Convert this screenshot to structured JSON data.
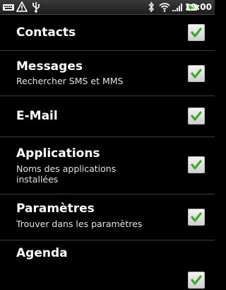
{
  "status_bar": {
    "time": "19:00",
    "left_icons": [
      "keyboard-icon",
      "warning-icon",
      "usb-debug-icon"
    ],
    "right_icons": [
      "bluetooth-icon",
      "wifi-icon",
      "signal-icon",
      "battery-icon"
    ]
  },
  "items": [
    {
      "title": "Contacts",
      "subtitle": "",
      "checked": true
    },
    {
      "title": "Messages",
      "subtitle": "Rechercher SMS et MMS",
      "checked": true
    },
    {
      "title": "E-Mail",
      "subtitle": "",
      "checked": true
    },
    {
      "title": "Applications",
      "subtitle_line1": "Noms des applications",
      "subtitle_line2": "installées",
      "checked": true
    },
    {
      "title": "Paramètres",
      "subtitle": "Trouver dans les paramètres",
      "checked": true
    },
    {
      "title": "Agenda",
      "subtitle": "",
      "checked": true
    }
  ],
  "colors": {
    "check_green": "#3dab24",
    "background": "#000000",
    "divider": "#3c3c3c"
  }
}
